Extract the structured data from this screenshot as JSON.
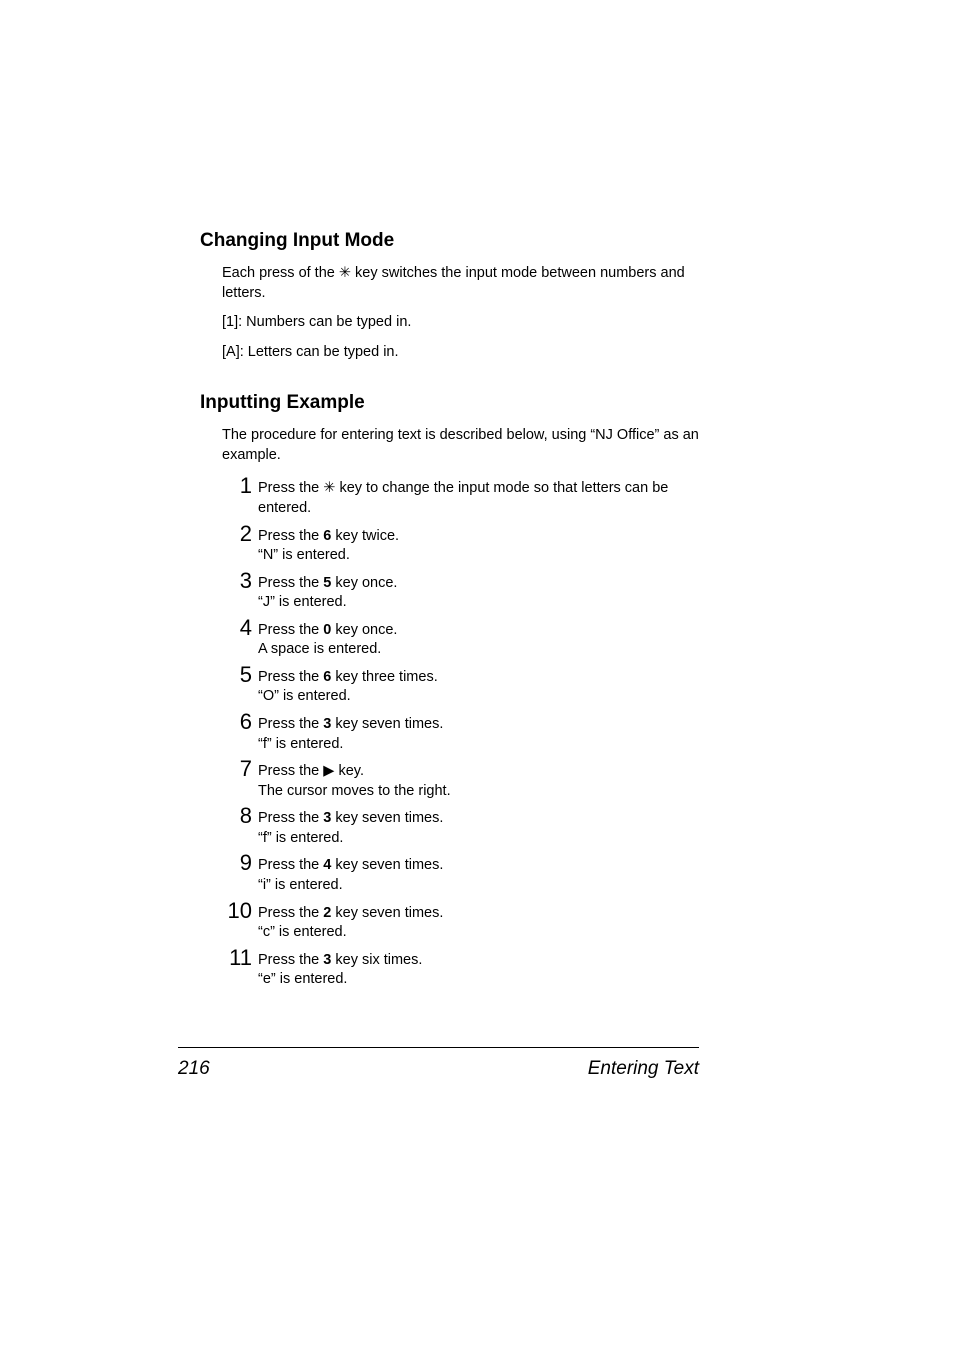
{
  "section1": {
    "heading": "Changing Input Mode",
    "p1a": "Each press of the ",
    "p1b": " key switches the input mode between numbers and letters.",
    "p2": "[1]: Numbers can be typed in.",
    "p3": "[A]: Letters can be typed in."
  },
  "section2": {
    "heading": "Inputting Example",
    "intro": "The procedure for entering text is described below, using “NJ Office” as an example.",
    "steps": [
      {
        "n": "1",
        "pre": "Press the ",
        "mid_is_icon": true,
        "key": "",
        "post": " key to change the input mode so that letters can be entered.",
        "result": ""
      },
      {
        "n": "2",
        "pre": "Press the ",
        "key": "6",
        "post": " key twice.",
        "result": "“N” is entered."
      },
      {
        "n": "3",
        "pre": "Press the ",
        "key": "5",
        "post": " key once.",
        "result": "“J” is entered."
      },
      {
        "n": "4",
        "pre": "Press the ",
        "key": "0",
        "post": " key once.",
        "result": "A space is entered."
      },
      {
        "n": "5",
        "pre": "Press the ",
        "key": "6",
        "post": " key three times.",
        "result": "“O” is entered."
      },
      {
        "n": "6",
        "pre": "Press the ",
        "key": "3",
        "post": " key seven times.",
        "result": "“f” is entered."
      },
      {
        "n": "7",
        "pre": "Press the ",
        "mid_is_arrow": true,
        "key": "",
        "post": " key.",
        "result": "The cursor moves to the right."
      },
      {
        "n": "8",
        "pre": "Press the ",
        "key": "3",
        "post": " key seven times.",
        "result": "“f” is entered."
      },
      {
        "n": "9",
        "pre": "Press the ",
        "key": "4",
        "post": " key seven times.",
        "result": "“i” is entered."
      },
      {
        "n": "10",
        "pre": "Press the ",
        "key": "2",
        "post": " key seven times.",
        "result": "“c” is entered."
      },
      {
        "n": "11",
        "pre": "Press the ",
        "key": "3",
        "post": " key six times.",
        "result": "“e” is entered."
      }
    ]
  },
  "footer": {
    "page_number": "216",
    "section_title": "Entering Text"
  },
  "icons": {
    "star": "✳",
    "right_arrow": "▶"
  }
}
